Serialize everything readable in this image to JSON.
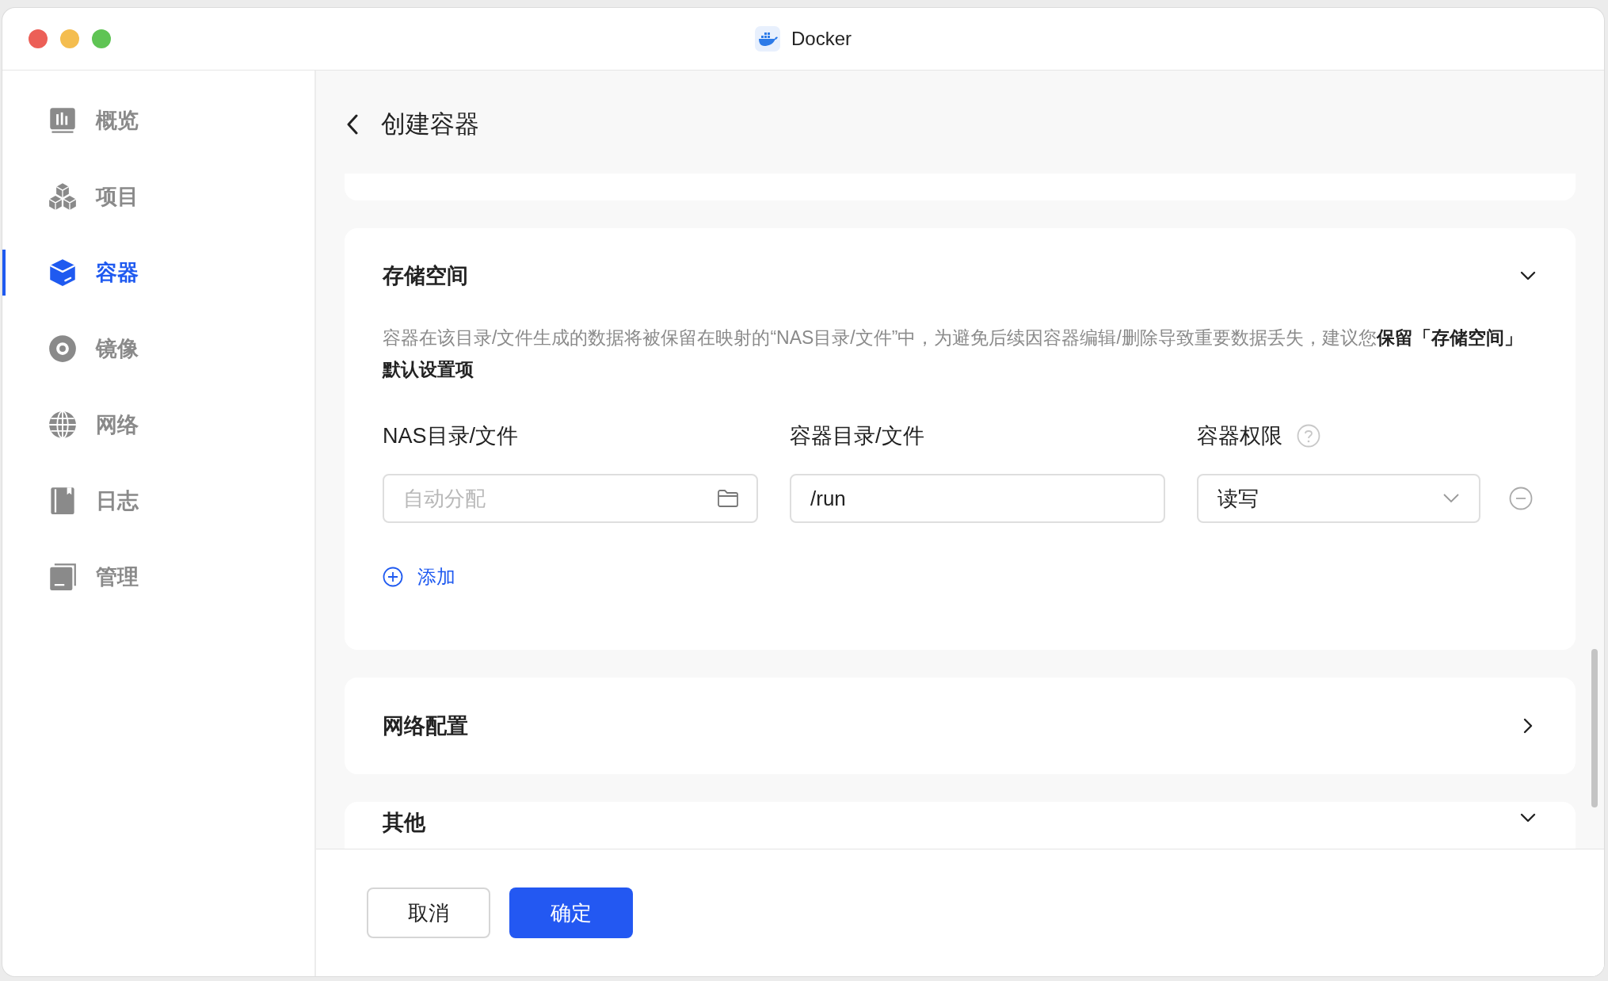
{
  "window": {
    "title": "Docker"
  },
  "sidebar": {
    "items": [
      {
        "label": "概览",
        "selected": false
      },
      {
        "label": "项目",
        "selected": false
      },
      {
        "label": "容器",
        "selected": true
      },
      {
        "label": "镜像",
        "selected": false
      },
      {
        "label": "网络",
        "selected": false
      },
      {
        "label": "日志",
        "selected": false
      },
      {
        "label": "管理",
        "selected": false
      }
    ]
  },
  "page": {
    "title": "创建容器"
  },
  "storage": {
    "title": "存储空间",
    "expanded": true,
    "description": "容器在该目录/文件生成的数据将被保留在映射的“NAS目录/文件”中，为避免后续因容器编辑/删除导致重要数据丢失，建议您**保留「存储空间」默认设置项**",
    "columns": [
      "NAS目录/文件",
      "容器目录/文件",
      "容器权限"
    ],
    "rows": [
      {
        "nas_path": {
          "placeholder": "自动分配"
        },
        "container_path": "/run",
        "permission": "读写"
      }
    ],
    "add_label": "添加"
  },
  "sections": [
    {
      "title": "网络配置",
      "expanded": false
    },
    {
      "title": "其他",
      "expanded": true
    }
  ],
  "buttons": [
    {
      "label": "取消",
      "kind": "secondary"
    },
    {
      "label": "确定",
      "kind": "primary"
    }
  ]
}
